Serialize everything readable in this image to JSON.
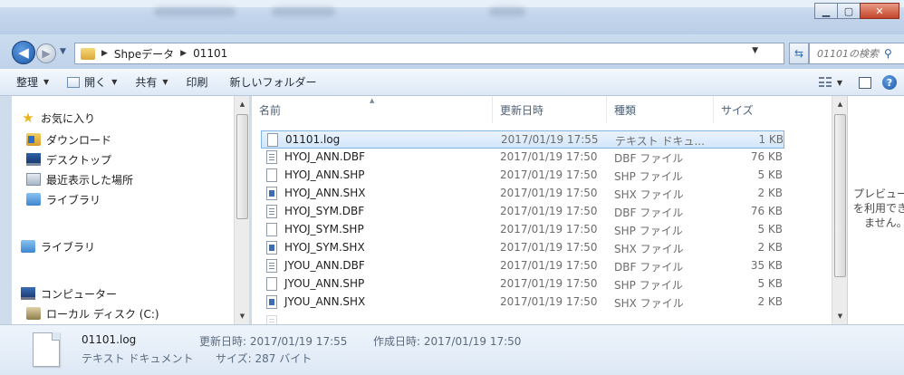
{
  "address": {
    "crumbs": [
      "Shpeデータ",
      "01101"
    ],
    "search_placeholder": "01101の検索"
  },
  "toolbar": {
    "organize": "整理",
    "open": "開く",
    "share": "共有",
    "print": "印刷",
    "new_folder": "新しいフォルダー"
  },
  "nav": {
    "favorites": "お気に入り",
    "downloads": "ダウンロード",
    "desktop": "デスクトップ",
    "recent": "最近表示した場所",
    "library_fav": "ライブラリ",
    "libraries": "ライブラリ",
    "computer": "コンピューター",
    "local_disk": "ローカル ディスク (C:)"
  },
  "columns": {
    "name": "名前",
    "modified": "更新日時",
    "type": "種類",
    "size": "サイズ"
  },
  "files": [
    {
      "name": "01101.log",
      "modified": "2017/01/19 17:55",
      "type": "テキスト ドキュ...",
      "size": "1 KB",
      "icon": "text-file-icon"
    },
    {
      "name": "HYOJ_ANN.DBF",
      "modified": "2017/01/19 17:50",
      "type": "DBF ファイル",
      "size": "76 KB",
      "icon": "dbf-file-icon"
    },
    {
      "name": "HYOJ_ANN.SHP",
      "modified": "2017/01/19 17:50",
      "type": "SHP ファイル",
      "size": "5 KB",
      "icon": "shp-file-icon"
    },
    {
      "name": "HYOJ_ANN.SHX",
      "modified": "2017/01/19 17:50",
      "type": "SHX ファイル",
      "size": "2 KB",
      "icon": "shx-file-icon"
    },
    {
      "name": "HYOJ_SYM.DBF",
      "modified": "2017/01/19 17:50",
      "type": "DBF ファイル",
      "size": "76 KB",
      "icon": "dbf-file-icon"
    },
    {
      "name": "HYOJ_SYM.SHP",
      "modified": "2017/01/19 17:50",
      "type": "SHP ファイル",
      "size": "5 KB",
      "icon": "shp-file-icon"
    },
    {
      "name": "HYOJ_SYM.SHX",
      "modified": "2017/01/19 17:50",
      "type": "SHX ファイル",
      "size": "2 KB",
      "icon": "shx-file-icon"
    },
    {
      "name": "JYOU_ANN.DBF",
      "modified": "2017/01/19 17:50",
      "type": "DBF ファイル",
      "size": "35 KB",
      "icon": "dbf-file-icon"
    },
    {
      "name": "JYOU_ANN.SHP",
      "modified": "2017/01/19 17:50",
      "type": "SHP ファイル",
      "size": "5 KB",
      "icon": "shp-file-icon"
    },
    {
      "name": "JYOU_ANN.SHX",
      "modified": "2017/01/19 17:50",
      "type": "SHX ファイル",
      "size": "2 KB",
      "icon": "shx-file-icon"
    }
  ],
  "preview": {
    "line1": "プレビュー",
    "line2": "を利用でき",
    "line3": "ません。"
  },
  "details": {
    "file_name": "01101.log",
    "file_type": "テキスト ドキュメント",
    "modified_label": "更新日時: 2017/01/19 17:55",
    "created_label": "作成日時: 2017/01/19 17:50",
    "size_label": "サイズ: 287 バイト"
  },
  "colors": {
    "selection_border": "#83b4e6",
    "selection_fill": "#d3e6fb",
    "close_button": "#c4452b"
  }
}
